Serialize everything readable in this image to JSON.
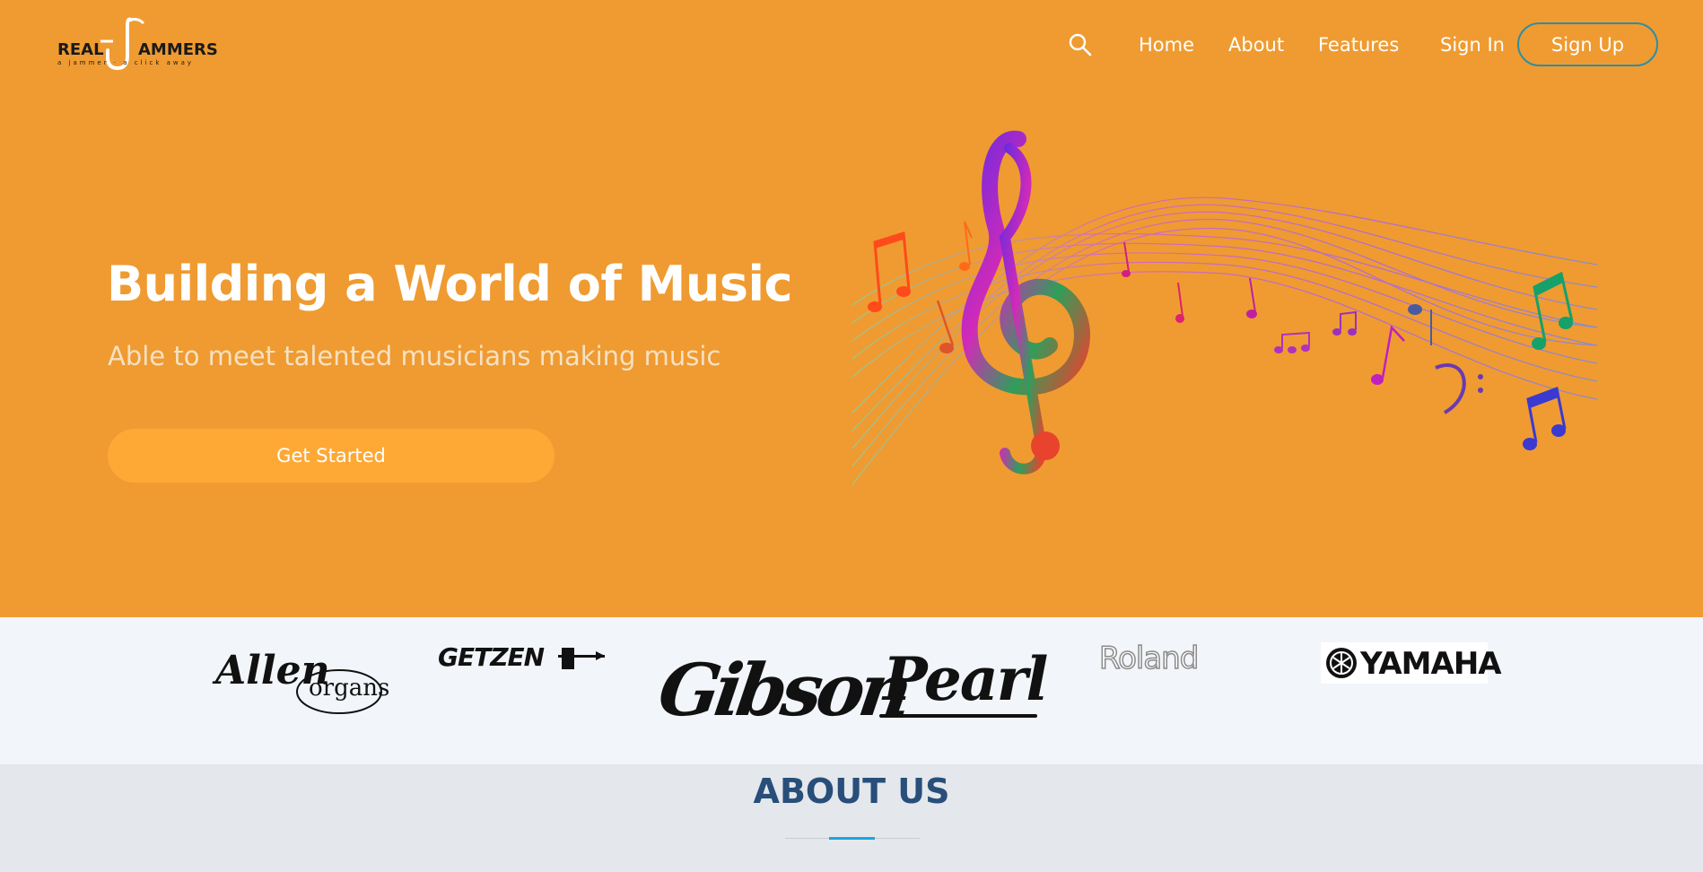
{
  "logo": {
    "left": "REAL",
    "right": "AMMERS",
    "tagline": "a jammer  ·  a click away"
  },
  "nav": {
    "search_icon": "search-icon",
    "links": [
      "Home",
      "About",
      "Features"
    ],
    "sign_in": "Sign In",
    "sign_up": "Sign Up"
  },
  "hero": {
    "title": "Building a World of Music",
    "subtitle": "Able to meet talented musicians making music",
    "cta": "Get Started",
    "image": "music-staff-treble-clef-illustration"
  },
  "brands": [
    {
      "name": "Allen",
      "sub": "organs"
    },
    {
      "name": "GETZEN"
    },
    {
      "name": "Gibson"
    },
    {
      "name": "Pearl"
    },
    {
      "name": "Roland"
    },
    {
      "name": "YAMAHA"
    }
  ],
  "about": {
    "title": "ABOUT US"
  },
  "colors": {
    "hero_bg": "#ef9b31",
    "cta_bg": "#fea835",
    "about_title": "#284e7a",
    "accent": "#1ba6e0"
  }
}
